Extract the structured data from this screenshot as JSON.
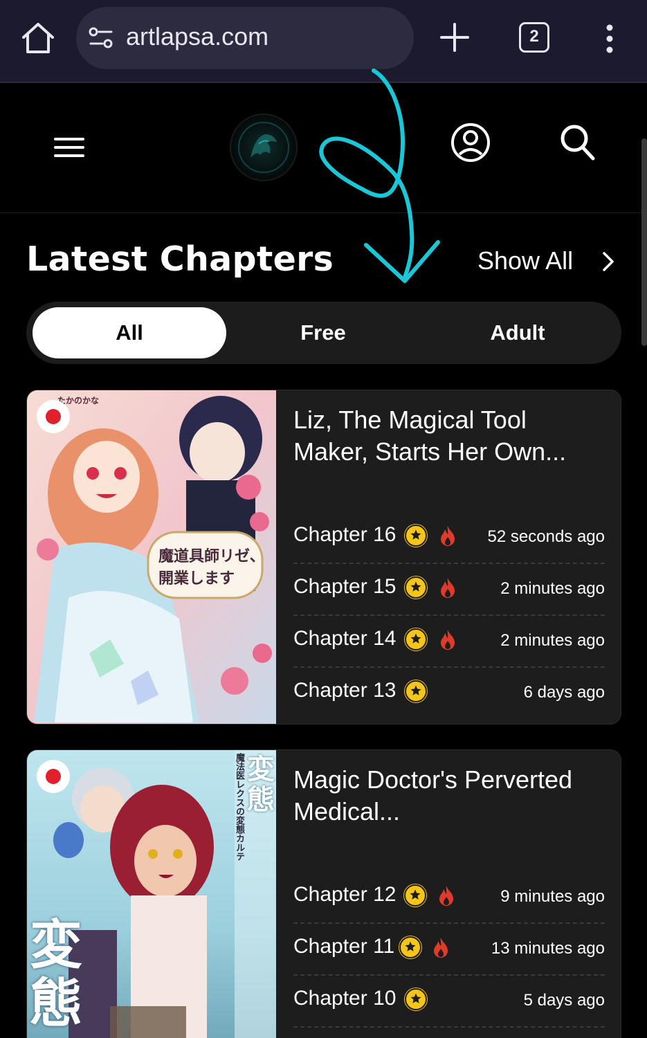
{
  "browser": {
    "url": "artlapsa.com",
    "tab_count": "2"
  },
  "section": {
    "title": "Latest Chapters",
    "show_all": "Show All"
  },
  "filters": [
    {
      "label": "All",
      "active": true
    },
    {
      "label": "Free",
      "active": false
    },
    {
      "label": "Adult",
      "active": false
    }
  ],
  "series": [
    {
      "title": "Liz, The Magical Tool Maker, Starts Her Own...",
      "cover_text": "魔道具師リゼ、開業します",
      "cover_credit": "たかのかな",
      "chapters": [
        {
          "label": "Chapter 16",
          "time": "52 seconds ago",
          "hot": true
        },
        {
          "label": "Chapter 15",
          "time": "2 minutes ago",
          "hot": true
        },
        {
          "label": "Chapter 14",
          "time": "2 minutes ago",
          "hot": true
        },
        {
          "label": "Chapter 13",
          "time": "6 days ago",
          "hot": false
        }
      ]
    },
    {
      "title": "Magic Doctor's Perverted Medical...",
      "cover_text": "魔法医レクスの変態カルテ",
      "cover_big": "変態",
      "chapters": [
        {
          "label": "Chapter 12",
          "time": "9 minutes ago",
          "hot": true
        },
        {
          "label": "Chapter 11",
          "time": "13 minutes ago",
          "hot": true
        },
        {
          "label": "Chapter 10",
          "time": "5 days ago",
          "hot": false
        }
      ]
    }
  ],
  "colors": {
    "accent_star": "#f5c518",
    "hot_icon": "#e03a2a",
    "annotation": "#18c8d8",
    "card_bg": "#1d1d1d"
  },
  "icons": [
    "home-icon",
    "site-settings-icon",
    "plus-icon",
    "tab-switcher-icon",
    "more-vert-icon",
    "hamburger-icon",
    "site-logo",
    "user-icon",
    "search-icon",
    "chevron-right-icon",
    "star-icon",
    "fire-icon"
  ]
}
